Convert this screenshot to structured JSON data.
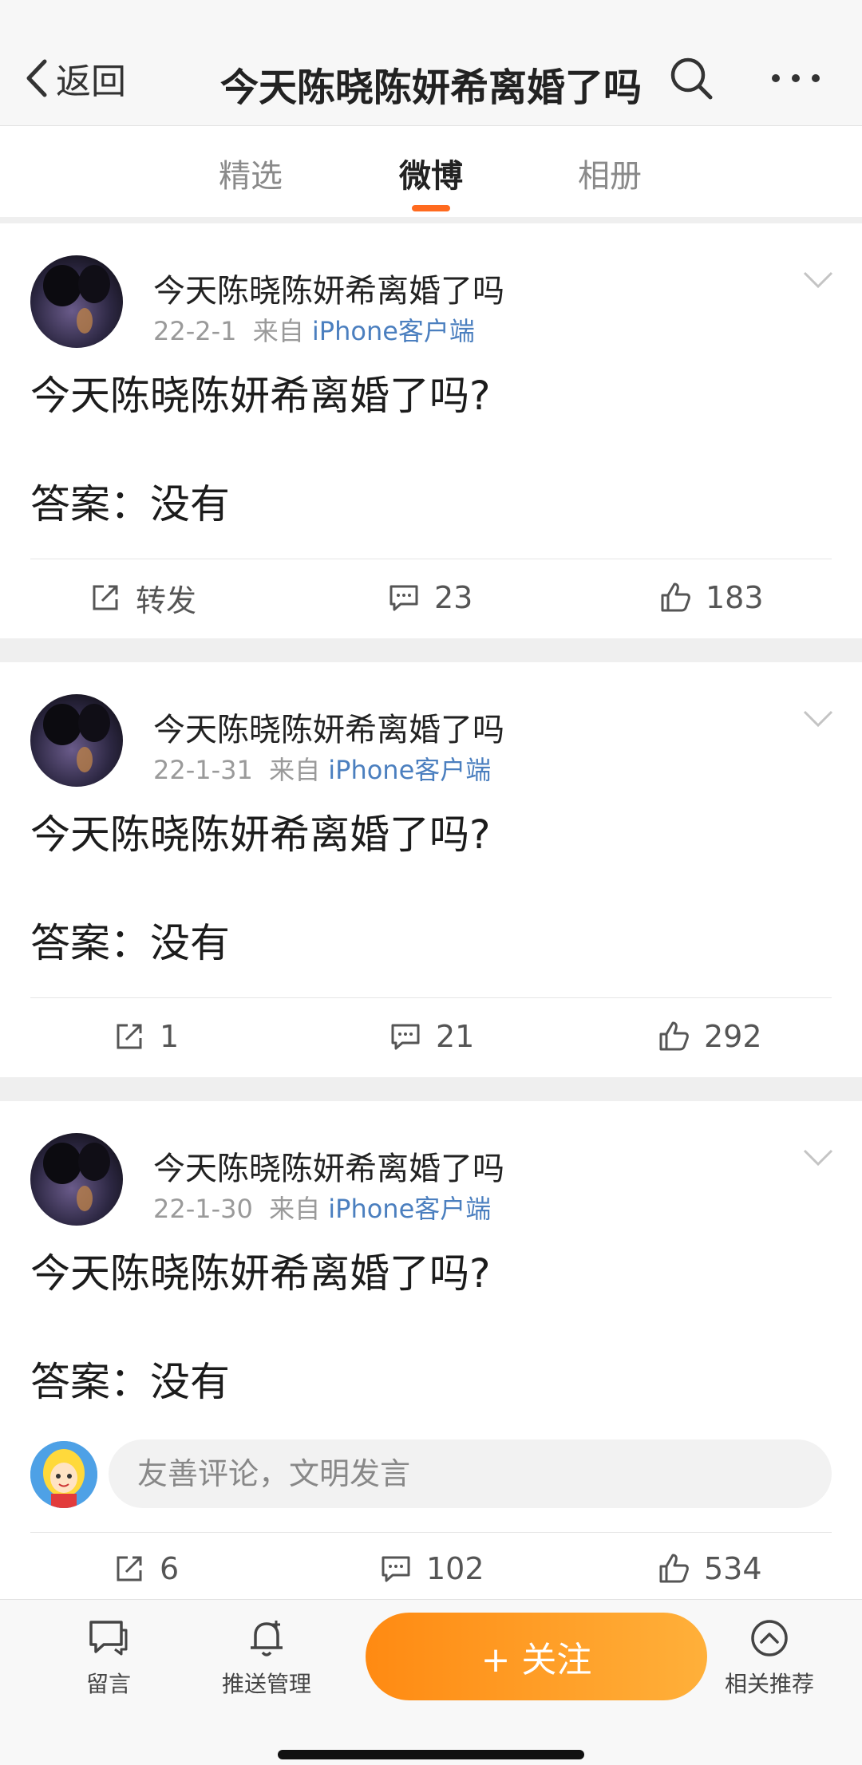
{
  "header": {
    "back_label": "返回",
    "title": "今天陈晓陈妍希离婚了吗"
  },
  "tabs": [
    {
      "label": "精选"
    },
    {
      "label": "微博"
    },
    {
      "label": "相册"
    }
  ],
  "active_tab": "微博",
  "posts": [
    {
      "author": "今天陈晓陈妍希离婚了吗",
      "date": "22-2-1",
      "source_prefix": "来自",
      "source": "iPhone客户端",
      "line1": "今天陈晓陈妍希离婚了吗?",
      "line2": "答案：没有",
      "repost": "转发",
      "comments": "23",
      "likes": "183"
    },
    {
      "author": "今天陈晓陈妍希离婚了吗",
      "date": "22-1-31",
      "source_prefix": "来自",
      "source": "iPhone客户端",
      "line1": "今天陈晓陈妍希离婚了吗?",
      "line2": "答案：没有",
      "repost": "1",
      "comments": "21",
      "likes": "292"
    },
    {
      "author": "今天陈晓陈妍希离婚了吗",
      "date": "22-1-30",
      "source_prefix": "来自",
      "source": "iPhone客户端",
      "line1": "今天陈晓陈妍希离婚了吗?",
      "line2": "答案：没有",
      "repost": "6",
      "comments": "102",
      "likes": "534"
    }
  ],
  "comment_placeholder": "友善评论，文明发言",
  "bottom_bar": {
    "message": "留言",
    "push": "推送管理",
    "follow": "+ 关注",
    "related": "相关推荐"
  },
  "colors": {
    "accent": "#ff6a1f",
    "link": "#4b7fbf",
    "follow_gradient_start": "#ff8a12",
    "follow_gradient_end": "#ffb03a"
  }
}
